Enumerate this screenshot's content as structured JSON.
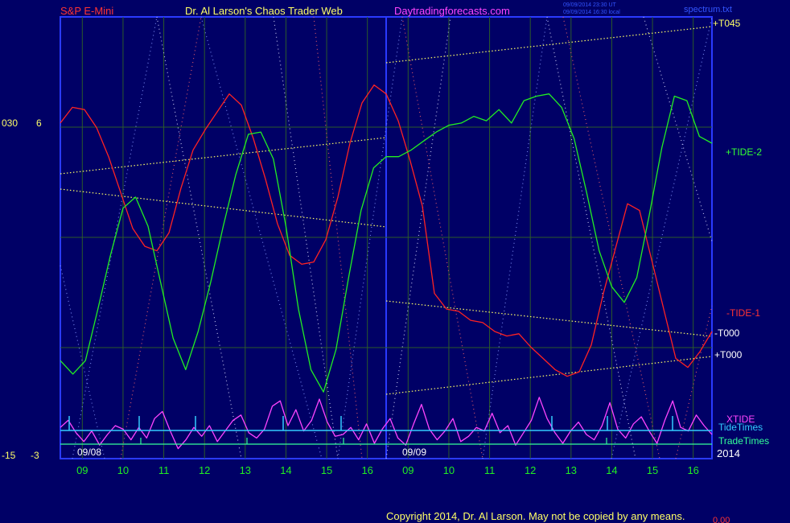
{
  "header": {
    "symbol": "S&P E-Mini",
    "title": "Dr. Al Larson's Chaos Trader Web",
    "site": "Daytradingforecasts.com",
    "stamp1": "09/09/2014 23:30 UT",
    "stamp2": "09/09/2014 16:30 local",
    "file": "spectrum.txt"
  },
  "axis": {
    "left_top_outer": "030",
    "left_top_inner": "6",
    "left_bottom_outer": "-15",
    "left_bottom_inner": "-3",
    "date1": "09/08",
    "date2": "09/09"
  },
  "right_labels": {
    "t045": "+T045",
    "tide2": "+TIDE-2",
    "tide1": "-TIDE-1",
    "t000_neg": "-T000",
    "t000_pos": "+T000",
    "xtide": "XTIDE",
    "tidetimes": "TideTimes",
    "tradetimes": "TradeTimes",
    "year": "2014"
  },
  "footer": {
    "copyright": "Copyright 2014, Dr. Al Larson. May not be copied by any means.",
    "value": "0.00"
  },
  "colors": {
    "background": "#000066",
    "frame": "#2a3aff",
    "grid": "#2b5a2b",
    "tide1": "#ff2222",
    "tide2": "#22ee22",
    "xtide": "#ff44ff",
    "channel": "#ffff66",
    "tidetimes": "#33ccff",
    "tradetimes": "#33ff99"
  },
  "chart_data": {
    "type": "line",
    "xlabel": "",
    "ylabel": "",
    "x_ticks": [
      "09",
      "10",
      "11",
      "12",
      "13",
      "14",
      "15",
      "16",
      "09",
      "10",
      "11",
      "12",
      "13",
      "14",
      "15",
      "16"
    ],
    "grid": true,
    "series": [
      {
        "name": "-TIDE-1",
        "color": "#ff2222",
        "values": [
          4.1,
          4.8,
          4.7,
          3.9,
          2.6,
          1.0,
          -0.6,
          -1.4,
          -1.6,
          -0.8,
          1.2,
          2.9,
          3.8,
          4.6,
          5.4,
          4.9,
          3.4,
          1.6,
          -0.4,
          -1.8,
          -2.2,
          -2.1,
          -1.1,
          0.8,
          3.2,
          5.0,
          5.8,
          5.4,
          4.2,
          2.4,
          0.4,
          -3.5,
          -4.2,
          -4.3,
          -4.7,
          -4.8,
          -5.2,
          -5.4,
          -5.3,
          -5.9,
          -6.4,
          -6.9,
          -7.2,
          -7.0,
          -5.8,
          -3.5,
          -1.5,
          0.5,
          0.2,
          -2.0,
          -4.2,
          -6.4,
          -6.8,
          -6.1,
          -5.2
        ]
      },
      {
        "name": "+TIDE-2",
        "color": "#22ee22",
        "values": [
          -6.5,
          -7.1,
          -6.5,
          -4.2,
          -1.8,
          0.3,
          0.8,
          -0.5,
          -3.0,
          -5.5,
          -6.9,
          -5.2,
          -3.0,
          -0.5,
          1.8,
          3.6,
          3.7,
          2.5,
          -0.5,
          -4.2,
          -6.9,
          -7.9,
          -6.0,
          -2.8,
          0.2,
          2.1,
          2.6,
          2.6,
          2.9,
          3.3,
          3.7,
          4.0,
          4.1,
          4.4,
          4.2,
          4.7,
          4.1,
          5.1,
          5.3,
          5.4,
          4.8,
          3.4,
          1.0,
          -1.6,
          -3.2,
          -3.9,
          -2.8,
          0.0,
          3.0,
          5.3,
          5.1,
          3.5,
          3.2
        ]
      },
      {
        "name": "XTIDE",
        "color": "#ff44ff",
        "values": [
          0.4,
          0.8,
          0.1,
          -0.4,
          0.2,
          -0.6,
          0.0,
          0.5,
          0.3,
          -0.3,
          0.4,
          -0.2,
          0.9,
          1.3,
          0.2,
          -0.8,
          -0.3,
          0.4,
          -0.1,
          0.5,
          -0.4,
          0.2,
          0.8,
          1.1,
          0.1,
          -0.2,
          0.3,
          1.6,
          1.9,
          0.5,
          1.4,
          0.2,
          0.8,
          2.0,
          0.7,
          -0.1,
          0.0,
          0.4,
          -0.3,
          0.6,
          -0.5,
          0.3,
          0.9,
          -0.2,
          -0.6,
          0.6,
          1.7,
          0.3,
          -0.3,
          0.2,
          0.9,
          -0.4,
          -0.1,
          0.4,
          0.2,
          1.2,
          0.1,
          0.5,
          -0.6,
          0.1,
          0.8,
          2.1,
          0.9,
          0.1,
          -0.5,
          0.2,
          0.7,
          0.0,
          -0.3,
          0.5,
          1.8,
          0.3,
          -0.2,
          0.6,
          1.0,
          0.2,
          -0.5,
          0.8,
          1.9,
          0.4,
          0.2,
          1.1,
          0.5,
          0.0
        ]
      }
    ]
  }
}
